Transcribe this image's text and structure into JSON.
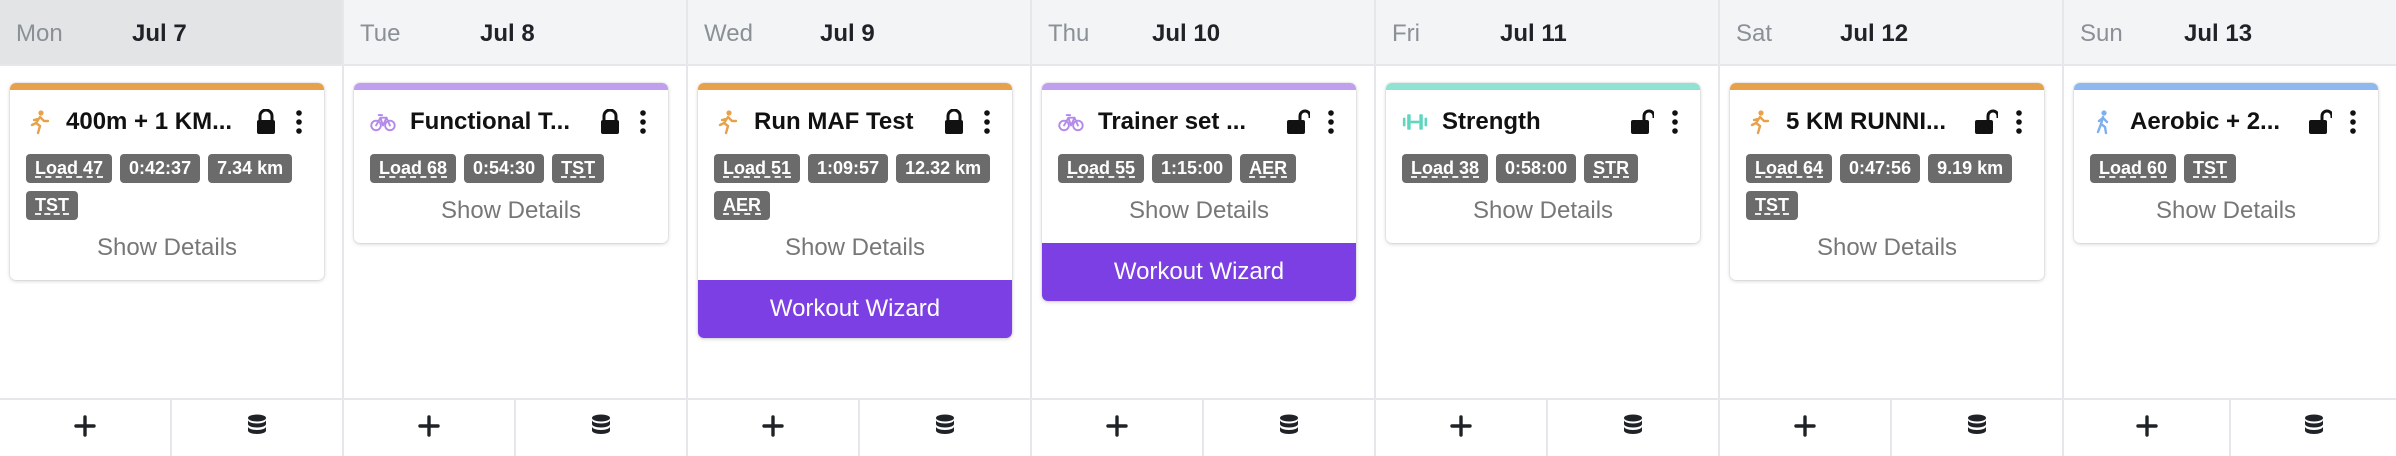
{
  "days": [
    {
      "dow": "Mon",
      "date": "Jul 7",
      "today": true,
      "card": {
        "sport": "run",
        "sport_icon": "running-icon",
        "color": "#e7a14a",
        "title": "400m + 1 KM...",
        "locked": true,
        "badges": [
          "Load 47",
          "0:42:37",
          "7.34 km",
          "TST"
        ],
        "details": "Show Details",
        "wizard": null
      }
    },
    {
      "dow": "Tue",
      "date": "Jul 8",
      "today": false,
      "card": {
        "sport": "bike",
        "sport_icon": "bike-icon",
        "color": "#c0a0ee",
        "title": "Functional T...",
        "locked": true,
        "badges": [
          "Load 68",
          "0:54:30",
          "TST"
        ],
        "details": "Show Details",
        "wizard": null
      }
    },
    {
      "dow": "Wed",
      "date": "Jul 9",
      "today": false,
      "card": {
        "sport": "run",
        "sport_icon": "running-icon",
        "color": "#e7a14a",
        "title": "Run MAF Test",
        "locked": true,
        "badges": [
          "Load 51",
          "1:09:57",
          "12.32 km",
          "AER"
        ],
        "details": "Show Details",
        "wizard": "Workout Wizard"
      }
    },
    {
      "dow": "Thu",
      "date": "Jul 10",
      "today": false,
      "card": {
        "sport": "bike",
        "sport_icon": "bike-icon",
        "color": "#c0a0ee",
        "title": "Trainer set ...",
        "locked": false,
        "badges": [
          "Load 55",
          "1:15:00",
          "AER"
        ],
        "details": "Show Details",
        "wizard": "Workout Wizard"
      }
    },
    {
      "dow": "Fri",
      "date": "Jul 11",
      "today": false,
      "card": {
        "sport": "strength",
        "sport_icon": "dumbbell-icon",
        "color": "#8fe3d0",
        "title": "Strength",
        "locked": false,
        "badges": [
          "Load 38",
          "0:58:00",
          "STR"
        ],
        "details": "Show Details",
        "wizard": null
      }
    },
    {
      "dow": "Sat",
      "date": "Jul 12",
      "today": false,
      "card": {
        "sport": "run",
        "sport_icon": "running-icon",
        "color": "#e7a14a",
        "title": "5 KM RUNNI...",
        "locked": false,
        "badges": [
          "Load 64",
          "0:47:56",
          "9.19 km",
          "TST"
        ],
        "details": "Show Details",
        "wizard": null
      }
    },
    {
      "dow": "Sun",
      "date": "Jul 13",
      "today": false,
      "card": {
        "sport": "walk",
        "sport_icon": "walking-icon",
        "color": "#8fb9ee",
        "title": "Aerobic + 2...",
        "locked": false,
        "badges": [
          "Load 60",
          "TST"
        ],
        "details": "Show Details",
        "wizard": null
      }
    }
  ],
  "footer": {
    "add_icon": "plus-icon",
    "library_icon": "database-icon"
  },
  "colors": {
    "wizard": "#7b3fe4",
    "badge": "#6b6b6b"
  }
}
